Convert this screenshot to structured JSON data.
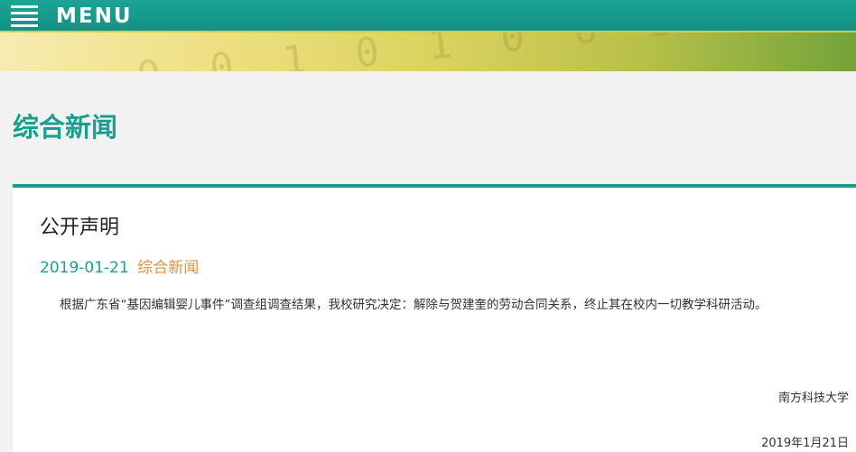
{
  "header": {
    "menu_label": "MENU"
  },
  "banner": {
    "digits": "0 0 1 0 1 0 0 1 1"
  },
  "section": {
    "title": "综合新闻"
  },
  "article": {
    "title": "公开声明",
    "date": "2019-01-21",
    "category": "综合新闻",
    "body": "根据广东省“基因编辑婴儿事件”调查组调查结果，我校研究决定：解除与贺建奎的劳动合同关系，终止其在校内一切教学科研活动。",
    "signature": "南方科技大学",
    "signed_date": "2019年1月21日"
  },
  "colors": {
    "brand": "#1a9e8e",
    "category": "#e0913f"
  }
}
